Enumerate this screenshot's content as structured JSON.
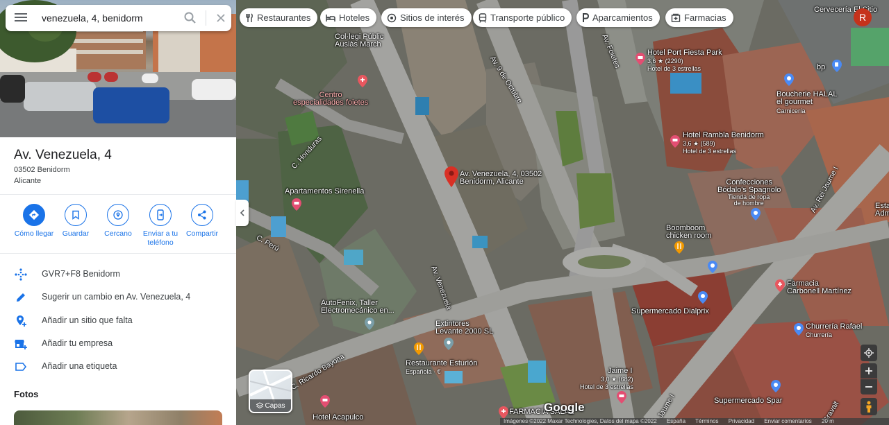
{
  "search": {
    "value": "venezuela, 4, benidorm"
  },
  "place": {
    "title": "Av. Venezuela, 4",
    "address_line1": "03502 Benidorm",
    "address_line2": "Alicante"
  },
  "actions": [
    {
      "label": "Cómo llegar",
      "icon": "directions-icon"
    },
    {
      "label": "Guardar",
      "icon": "bookmark-icon"
    },
    {
      "label": "Cercano",
      "icon": "nearby-icon"
    },
    {
      "label": "Enviar a tu teléfono",
      "icon": "send-to-phone-icon"
    },
    {
      "label": "Compartir",
      "icon": "share-icon"
    }
  ],
  "info_rows": [
    {
      "text": "GVR7+F8 Benidorm",
      "icon": "plus-code-icon"
    },
    {
      "text": "Sugerir un cambio en Av. Venezuela, 4",
      "icon": "pencil-icon"
    },
    {
      "text": "Añadir un sitio que falta",
      "icon": "add-place-icon"
    },
    {
      "text": "Añadir tu empresa",
      "icon": "add-business-icon"
    },
    {
      "text": "Añadir una etiqueta",
      "icon": "label-icon"
    }
  ],
  "photos_heading": "Fotos",
  "chips": [
    {
      "label": "Restaurantes",
      "icon": "restaurant-icon"
    },
    {
      "label": "Hoteles",
      "icon": "hotel-icon"
    },
    {
      "label": "Sitios de interés",
      "icon": "camera-icon"
    },
    {
      "label": "Transporte público",
      "icon": "transit-icon"
    },
    {
      "label": "Aparcamientos",
      "icon": "parking-icon"
    },
    {
      "label": "Farmacias",
      "icon": "pharmacy-icon"
    }
  ],
  "user": {
    "initial": "R"
  },
  "map": {
    "pois": {
      "colegio": [
        "Col·legi Públic",
        "Ausiàs March"
      ],
      "centro": [
        "Centro",
        "especialidades foietes"
      ],
      "hotel_port": "Hotel Port Fiesta Park",
      "hotel_port_rating": "3,6 ★ (2290)",
      "hotel_port_sub": "Hotel de 3 estrellas",
      "cerveceria": "Cervecería El Sitio",
      "bp": "bp",
      "boucherie": [
        "Boucherie HALAL",
        "el gourmet"
      ],
      "boucherie_sub": "Carnicería",
      "hotel_rambla": "Hotel Rambla Benidorm",
      "hotel_rambla_rating": "3,6 ★ (589)",
      "hotel_rambla_sub": "Hotel de 3 estrellas",
      "selected": [
        "Av. Venezuela, 4, 03502",
        "Benidorm, Alicante"
      ],
      "apartamentos": "Apartamentos Sirenella",
      "confecciones": [
        "Confecciones",
        "Bódalo's Spagnolo"
      ],
      "confecciones_sub": [
        "Tienda de ropa",
        "de hombre"
      ],
      "boomboom": [
        "Boomboom",
        "chicken room"
      ],
      "esta": [
        "Esta",
        "Adm"
      ],
      "autofenix": [
        "AutoFenix, Taller",
        "Electromecánico en..."
      ],
      "supermercado_dialprix": "Supermercado Dialprix",
      "farmacia_carbonell": [
        "Farmacia",
        "Carbonell Martínez"
      ],
      "churreria": "Churrería Rafael",
      "churreria_sub": "Churrería",
      "extintores": [
        "Extintores",
        "Levante 2000 SL"
      ],
      "restaurante": "Restaurante Esturión",
      "restaurante_sub": "Española · €",
      "jaime": "Jaime I",
      "jaime_rating": "3,0 ★ (682)",
      "jaime_sub": "Hotel de 3 estrellas",
      "supermercado_spar": "Supermercado Spar",
      "farmacia_salazar": "FARMACIA SALAZ",
      "hotel_acapulco": "Hotel Acapulco"
    },
    "streets": {
      "honduras": "C. Honduras",
      "peru": "C. Perú",
      "venezuela": "Av. Venezuela",
      "nueve_octubre": "Av. 9 de Octubre",
      "foietes": "Av. Foietes",
      "rei_jaume": "Av. Rei Jaume I",
      "ricardo_bayona": "C. Ricardo Bayona",
      "jaume": "Jaume I",
      "gravalt": "Gravalt"
    },
    "layers_label": "Capas",
    "google_logo": "Google",
    "footer": [
      "Imágenes ©2022 Maxar Technologies, Datos del mapa ©2022",
      "España",
      "Términos",
      "Privacidad",
      "Enviar comentarios",
      "20 m"
    ]
  }
}
